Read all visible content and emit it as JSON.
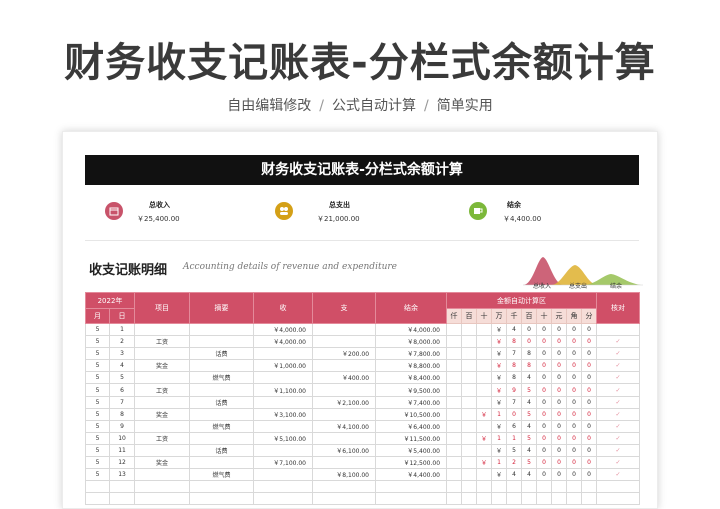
{
  "page": {
    "title": "财务收支记账表-分栏式余额计算",
    "subtitle_items": [
      "自由编辑修改",
      "公式自动计算",
      "简单实用"
    ],
    "subtitle_sep": "/"
  },
  "doc": {
    "title": "财务收支记账表-分栏式余额计算",
    "summary": [
      {
        "label": "总收入",
        "value": "￥25,400.00",
        "icon": "calendar-icon",
        "color": "#c8536a"
      },
      {
        "label": "总支出",
        "value": "￥21,000.00",
        "icon": "users-icon",
        "color": "#d4a017"
      },
      {
        "label": "结余",
        "value": "￥4,400.00",
        "icon": "cup-icon",
        "color": "#7cb83a"
      }
    ],
    "section_title": "收支记账明细",
    "section_subtitle": "Accounting details of revenue and expenditure",
    "legend": [
      {
        "label": "总收入",
        "color": "#c8536a"
      },
      {
        "label": "总支出",
        "color": "#e0b53a"
      },
      {
        "label": "结余",
        "color": "#9bc35a"
      }
    ]
  },
  "table": {
    "year": "2022年",
    "month_label": "月",
    "day_label": "日",
    "headers": {
      "item": "项目",
      "memo": "摘要",
      "income": "收",
      "expense": "支",
      "balance": "结余",
      "calc": "金额自动计算区",
      "check": "核对"
    },
    "digits": [
      "仟",
      "百",
      "十",
      "万",
      "千",
      "百",
      "十",
      "元",
      "角",
      "分"
    ],
    "rows": [
      {
        "m": "5",
        "d": "1",
        "item": "",
        "memo": "",
        "inc": "￥4,000.00",
        "exp": "",
        "bal": "￥4,000.00",
        "dg": [
          "",
          "",
          "",
          "￥",
          "4",
          "0",
          "0",
          "0",
          "0",
          "0"
        ],
        "red": false,
        "chk": ""
      },
      {
        "m": "5",
        "d": "2",
        "item": "工资",
        "memo": "",
        "inc": "￥4,000.00",
        "exp": "",
        "bal": "￥8,000.00",
        "dg": [
          "",
          "",
          "",
          "￥",
          "8",
          "0",
          "0",
          "0",
          "0",
          "0"
        ],
        "red": true,
        "chk": "✓"
      },
      {
        "m": "5",
        "d": "3",
        "item": "",
        "memo": "话费",
        "inc": "",
        "exp": "￥200.00",
        "bal": "￥7,800.00",
        "dg": [
          "",
          "",
          "",
          "￥",
          "7",
          "8",
          "0",
          "0",
          "0",
          "0"
        ],
        "red": false,
        "chk": "✓"
      },
      {
        "m": "5",
        "d": "4",
        "item": "奖金",
        "memo": "",
        "inc": "￥1,000.00",
        "exp": "",
        "bal": "￥8,800.00",
        "dg": [
          "",
          "",
          "",
          "￥",
          "8",
          "8",
          "0",
          "0",
          "0",
          "0"
        ],
        "red": true,
        "chk": "✓"
      },
      {
        "m": "5",
        "d": "5",
        "item": "",
        "memo": "燃气费",
        "inc": "",
        "exp": "￥400.00",
        "bal": "￥8,400.00",
        "dg": [
          "",
          "",
          "",
          "￥",
          "8",
          "4",
          "0",
          "0",
          "0",
          "0"
        ],
        "red": false,
        "chk": "✓"
      },
      {
        "m": "5",
        "d": "6",
        "item": "工资",
        "memo": "",
        "inc": "￥1,100.00",
        "exp": "",
        "bal": "￥9,500.00",
        "dg": [
          "",
          "",
          "",
          "￥",
          "9",
          "5",
          "0",
          "0",
          "0",
          "0"
        ],
        "red": true,
        "chk": "✓"
      },
      {
        "m": "5",
        "d": "7",
        "item": "",
        "memo": "话费",
        "inc": "",
        "exp": "￥2,100.00",
        "bal": "￥7,400.00",
        "dg": [
          "",
          "",
          "",
          "￥",
          "7",
          "4",
          "0",
          "0",
          "0",
          "0"
        ],
        "red": false,
        "chk": "✓"
      },
      {
        "m": "5",
        "d": "8",
        "item": "奖金",
        "memo": "",
        "inc": "￥3,100.00",
        "exp": "",
        "bal": "￥10,500.00",
        "dg": [
          "",
          "",
          "￥",
          "1",
          "0",
          "5",
          "0",
          "0",
          "0",
          "0"
        ],
        "red": true,
        "chk": "✓"
      },
      {
        "m": "5",
        "d": "9",
        "item": "",
        "memo": "燃气费",
        "inc": "",
        "exp": "￥4,100.00",
        "bal": "￥6,400.00",
        "dg": [
          "",
          "",
          "",
          "￥",
          "6",
          "4",
          "0",
          "0",
          "0",
          "0"
        ],
        "red": false,
        "chk": "✓"
      },
      {
        "m": "5",
        "d": "10",
        "item": "工资",
        "memo": "",
        "inc": "￥5,100.00",
        "exp": "",
        "bal": "￥11,500.00",
        "dg": [
          "",
          "",
          "￥",
          "1",
          "1",
          "5",
          "0",
          "0",
          "0",
          "0"
        ],
        "red": true,
        "chk": "✓"
      },
      {
        "m": "5",
        "d": "11",
        "item": "",
        "memo": "话费",
        "inc": "",
        "exp": "￥6,100.00",
        "bal": "￥5,400.00",
        "dg": [
          "",
          "",
          "",
          "￥",
          "5",
          "4",
          "0",
          "0",
          "0",
          "0"
        ],
        "red": false,
        "chk": "✓"
      },
      {
        "m": "5",
        "d": "12",
        "item": "奖金",
        "memo": "",
        "inc": "￥7,100.00",
        "exp": "",
        "bal": "￥12,500.00",
        "dg": [
          "",
          "",
          "￥",
          "1",
          "2",
          "5",
          "0",
          "0",
          "0",
          "0"
        ],
        "red": true,
        "chk": "✓"
      },
      {
        "m": "5",
        "d": "13",
        "item": "",
        "memo": "燃气费",
        "inc": "",
        "exp": "￥8,100.00",
        "bal": "￥4,400.00",
        "dg": [
          "",
          "",
          "",
          "￥",
          "4",
          "4",
          "0",
          "0",
          "0",
          "0"
        ],
        "red": false,
        "chk": "✓"
      }
    ]
  }
}
